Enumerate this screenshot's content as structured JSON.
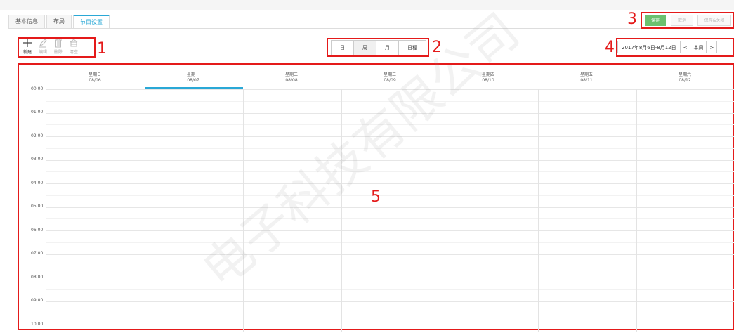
{
  "tabs": [
    {
      "label": "基本信息",
      "active": false
    },
    {
      "label": "布局",
      "active": false
    },
    {
      "label": "节目设置",
      "active": true
    }
  ],
  "toolbar": {
    "items": [
      {
        "name": "new",
        "label": "新建",
        "icon": "plus-icon",
        "enabled": true
      },
      {
        "name": "edit",
        "label": "编辑",
        "icon": "pencil-icon",
        "enabled": false
      },
      {
        "name": "delete",
        "label": "删除",
        "icon": "trash-icon",
        "enabled": false
      },
      {
        "name": "clear",
        "label": "清空",
        "icon": "eraser-icon",
        "enabled": false
      }
    ]
  },
  "view_switch": {
    "options": [
      {
        "label": "日",
        "selected": false
      },
      {
        "label": "周",
        "selected": true
      },
      {
        "label": "月",
        "selected": false
      },
      {
        "label": "日程",
        "selected": false
      }
    ]
  },
  "actions": {
    "save": "保存",
    "cancel": "取消",
    "save_and_close": "保存&关闭"
  },
  "date_nav": {
    "range": "2017年8月6日-8月12日",
    "prev": "<",
    "this_week": "本周",
    "next": ">"
  },
  "calendar": {
    "days": [
      {
        "name": "星期日",
        "date": "08/06",
        "active": false
      },
      {
        "name": "星期一",
        "date": "08/07",
        "active": true
      },
      {
        "name": "星期二",
        "date": "08/08",
        "active": false
      },
      {
        "name": "星期三",
        "date": "08/09",
        "active": false
      },
      {
        "name": "星期四",
        "date": "08/10",
        "active": false
      },
      {
        "name": "星期五",
        "date": "08/11",
        "active": false
      },
      {
        "name": "星期六",
        "date": "08/12",
        "active": false
      }
    ],
    "times": [
      "00:00",
      "01:00",
      "02:00",
      "03:00",
      "04:00",
      "05:00",
      "06:00",
      "07:00",
      "08:00",
      "09:00",
      "10:00"
    ]
  },
  "markers": {
    "m1": "1",
    "m2": "2",
    "m3": "3",
    "m4": "4",
    "m5": "5"
  },
  "watermark": "电子科技有限公司",
  "colors": {
    "accent": "#2aa8d6",
    "save_green": "#6cc06f",
    "annotation_red": "#e41a1a"
  }
}
